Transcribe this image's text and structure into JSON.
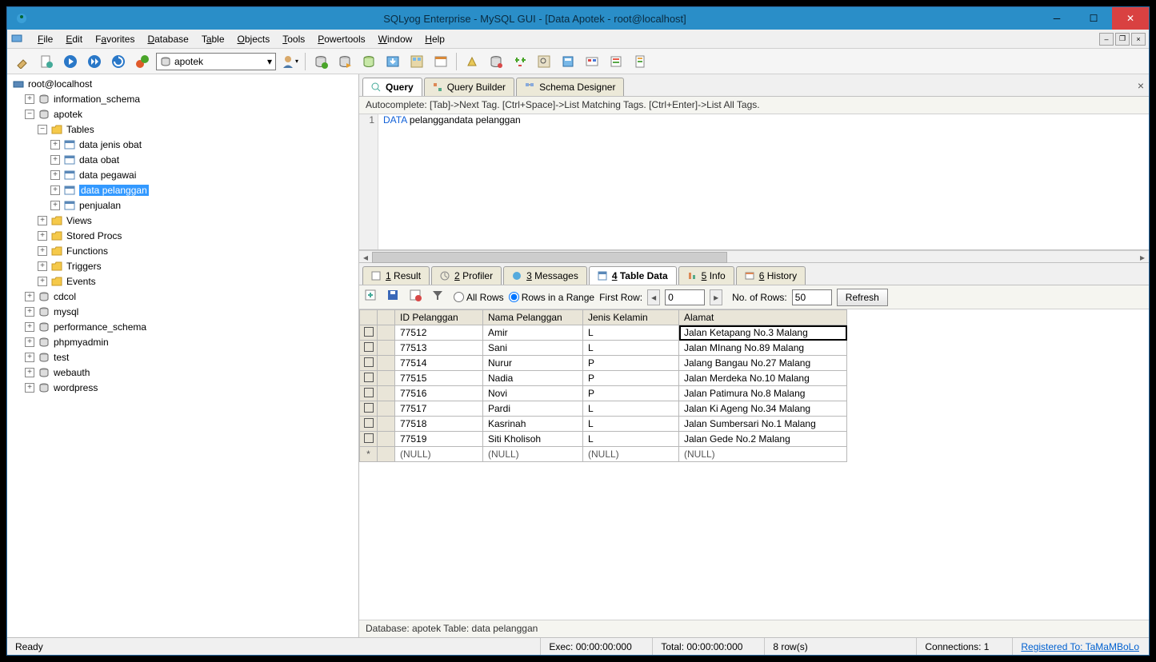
{
  "title": "SQLyog Enterprise - MySQL GUI - [Data Apotek - root@localhost]",
  "menus": {
    "file": "File",
    "edit": "Edit",
    "favorites": "Favorites",
    "database": "Database",
    "table": "Table",
    "objects": "Objects",
    "tools": "Tools",
    "powertools": "Powertools",
    "window": "Window",
    "help": "Help"
  },
  "toolbar": {
    "db_selected": "apotek"
  },
  "tree": {
    "root": "root@localhost",
    "dbs": {
      "information_schema": "information_schema",
      "apotek": "apotek",
      "cdcol": "cdcol",
      "mysql": "mysql",
      "performance_schema": "performance_schema",
      "phpmyadmin": "phpmyadmin",
      "test": "test",
      "webauth": "webauth",
      "wordpress": "wordpress"
    },
    "folders": {
      "tables": "Tables",
      "views": "Views",
      "procs": "Stored Procs",
      "functions": "Functions",
      "triggers": "Triggers",
      "events": "Events"
    },
    "tables": {
      "data_jenis_obat": "data jenis obat",
      "data_obat": "data obat",
      "data_pegawai": "data pegawai",
      "data_pelanggan": "data pelanggan",
      "penjualan": "penjualan"
    }
  },
  "query_tabs": {
    "query": "Query",
    "builder": "Query Builder",
    "schema": "Schema Designer"
  },
  "hint": "Autocomplete: [Tab]->Next Tag. [Ctrl+Space]->List Matching Tags. [Ctrl+Enter]->List All Tags.",
  "editor": {
    "line1_kw": "DATA",
    "line1_rest": " pelanggandata pelanggan",
    "lineno": "1"
  },
  "result_tabs": {
    "result": "Result",
    "profiler": "Profiler",
    "messages": "Messages",
    "tabledata": "Table Data",
    "info": "Info",
    "history": "History"
  },
  "data_toolbar": {
    "all_rows": "All Rows",
    "rows_range": "Rows in a Range",
    "first_row_label": "First Row:",
    "first_row_value": "0",
    "no_rows_label": "No. of Rows:",
    "no_rows_value": "50",
    "refresh": "Refresh"
  },
  "grid": {
    "columns": [
      "ID Pelanggan",
      "Nama Pelanggan",
      "Jenis Kelamin",
      "Alamat"
    ],
    "rows": [
      [
        "77512",
        "Amir",
        "L",
        "Jalan Ketapang No.3 Malang"
      ],
      [
        "77513",
        "Sani",
        "L",
        "Jalan MInang No.89 Malang"
      ],
      [
        "77514",
        "Nurur",
        "P",
        "Jalang Bangau No.27 Malang"
      ],
      [
        "77515",
        "Nadia",
        "P",
        "Jalan Merdeka No.10 Malang"
      ],
      [
        "77516",
        "Novi",
        "P",
        "Jalan Patimura No.8 Malang"
      ],
      [
        "77517",
        "Pardi",
        "L",
        "Jalan Ki Ageng No.34 Malang"
      ],
      [
        "77518",
        "Kasrinah",
        "L",
        "Jalan Sumbersari No.1 Malang"
      ],
      [
        "77519",
        "Siti Kholisoh",
        "L",
        "Jalan Gede No.2 Malang"
      ]
    ],
    "null_label": "(NULL)",
    "new_row_marker": "*"
  },
  "status_info": "Database: apotek Table: data pelanggan",
  "statusbar": {
    "ready": "Ready",
    "exec": "Exec: 00:00:00:000",
    "total": "Total: 00:00:00:000",
    "rows": "8 row(s)",
    "conn": "Connections: 1",
    "registered": "Registered To: TaMaMBoLo"
  }
}
